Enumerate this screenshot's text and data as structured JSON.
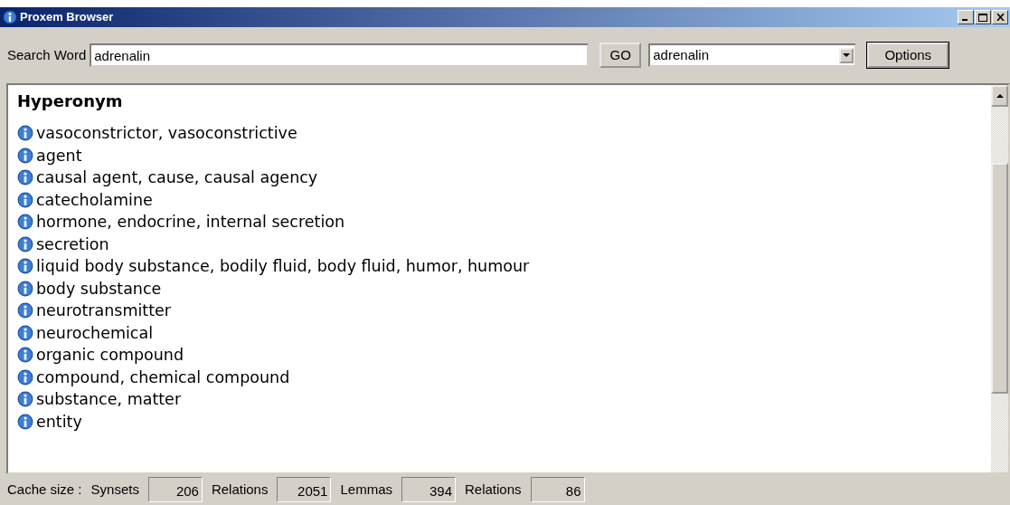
{
  "window": {
    "title": "Proxem Browser"
  },
  "toolbar": {
    "search_label": "Search Word",
    "search_value": "adrenalin",
    "go_button": "GO",
    "dropdown_value": "adrenalin",
    "options_button": "Options"
  },
  "content": {
    "heading": "Hyperonym",
    "items": [
      {
        "text": "vasoconstrictor, vasoconstrictive"
      },
      {
        "text": "agent"
      },
      {
        "text": "causal agent, cause, causal agency"
      },
      {
        "text": "catecholamine"
      },
      {
        "text": "hormone, endocrine, internal secretion"
      },
      {
        "text": "secretion"
      },
      {
        "text": "liquid body substance, bodily fluid, body fluid, humor, humour"
      },
      {
        "text": "body substance"
      },
      {
        "text": "neurotransmitter"
      },
      {
        "text": "neurochemical"
      },
      {
        "text": "organic compound"
      },
      {
        "text": "compound, chemical compound"
      },
      {
        "text": "substance, matter"
      },
      {
        "text": "entity"
      }
    ]
  },
  "status_bar": {
    "label": "Cache size :",
    "fields": [
      {
        "label": "Synsets",
        "value": "206"
      },
      {
        "label": "Relations",
        "value": "2051"
      },
      {
        "label": "Lemmas",
        "value": "394"
      },
      {
        "label": "Relations",
        "value": "86"
      }
    ]
  }
}
